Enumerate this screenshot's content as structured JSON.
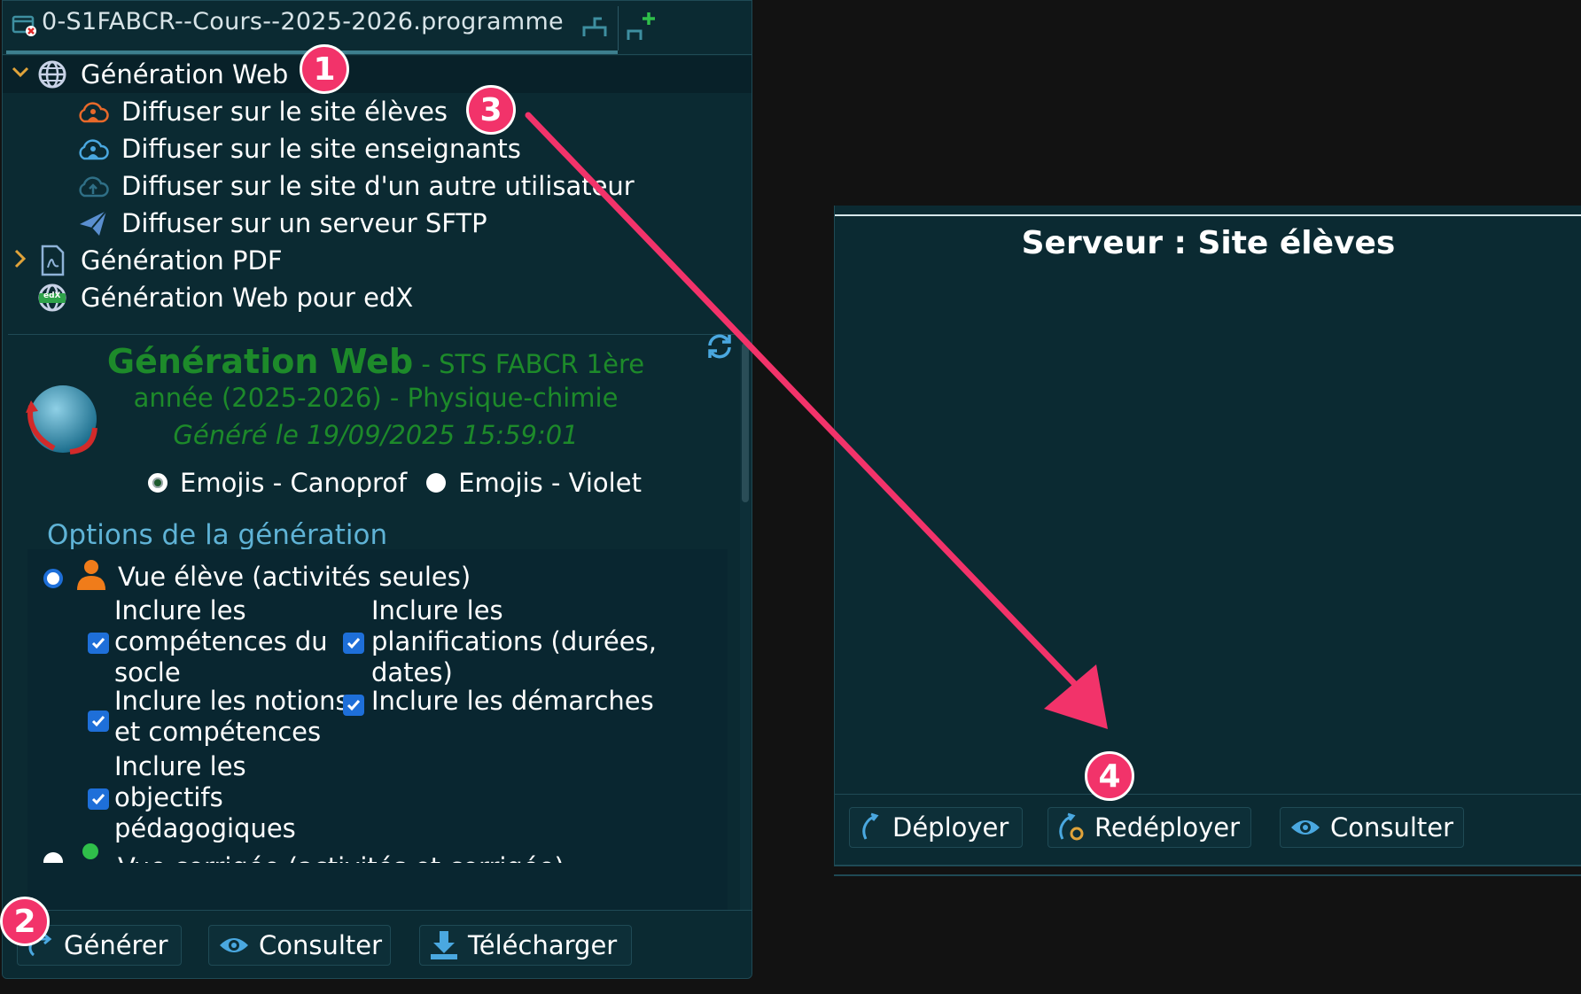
{
  "tab": {
    "title": "0-S1FABCR--Cours--2025-2026.programme"
  },
  "tree": {
    "generation_web": "Génération Web",
    "diffuser_eleves": "Diffuser sur le site élèves",
    "diffuser_enseignants": "Diffuser sur le site enseignants",
    "diffuser_autre": "Diffuser sur le site d'un autre utilisateur",
    "diffuser_sftp": "Diffuser sur un serveur SFTP",
    "generation_pdf": "Génération PDF",
    "generation_edx": "Génération Web pour edX",
    "edx_badge": "edX"
  },
  "detail": {
    "title": "Génération Web",
    "subtitle_line1": " - STS FABCR 1ère",
    "subtitle_line2": "année (2025-2026) - Physique-chimie",
    "generated": "Généré le 19/09/2025 15:59:01",
    "theme_canoprof": "Emojis - Canoprof",
    "theme_violet": "Emojis - Violet"
  },
  "options": {
    "header": "Options de la génération",
    "vue_eleve": "Vue élève (activités seules)",
    "competences_socle": "Inclure les\ncompétences du\nsocle",
    "planifications": "Inclure les\nplanifications (durées,\ndates)",
    "notions": "Inclure les notions\net compétences",
    "demarches": "Inclure les démarches",
    "objectifs": "Inclure les\nobjectifs\npédagogiques",
    "vue_corrigee_partial": "Vue corrigée (activités et corrigée)"
  },
  "left_buttons": {
    "generer": "Générer",
    "consulter": "Consulter",
    "telecharger": "Télécharger"
  },
  "server": {
    "title": "Serveur : Site élèves",
    "deployer": "Déployer",
    "redeployer": "Redéployer",
    "consulter": "Consulter"
  },
  "badges": [
    "1",
    "2",
    "3",
    "4"
  ],
  "colors": {
    "panel_bg": "#0b2a32",
    "accent_green": "#1d8a2a",
    "options_blue": "#5fb3d6",
    "badge_pink": "#f2336a",
    "checkbox_blue": "#1e6fd9"
  }
}
